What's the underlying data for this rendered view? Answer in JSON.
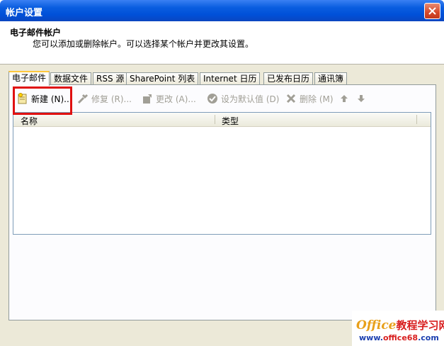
{
  "window": {
    "title": "帐户设置"
  },
  "header": {
    "title": "电子邮件帐户",
    "description": "您可以添加或删除帐户。可以选择某个帐户并更改其设置。"
  },
  "tabs": [
    "电子邮件",
    "数据文件",
    "RSS 源",
    "SharePoint 列表",
    "Internet 日历",
    "已发布日历",
    "通讯簿"
  ],
  "active_tab": "电子邮件",
  "toolbar": {
    "new": "新建 (N)...",
    "repair": "修复 (R)...",
    "change": "更改 (A)...",
    "set_default": "设为默认值 (D)",
    "remove": "删除 (M)"
  },
  "list": {
    "columns": [
      "名称",
      "类型"
    ]
  },
  "watermark": {
    "brand": "Office",
    "brand_cn": "教程学习网",
    "url_prefix": "www.",
    "url_mid": "office68",
    "url_suffix": ".com"
  },
  "colors": {
    "title_bar": "#0a5ee0",
    "highlight": "#e01010",
    "tab_accent": "#ffc83c"
  }
}
